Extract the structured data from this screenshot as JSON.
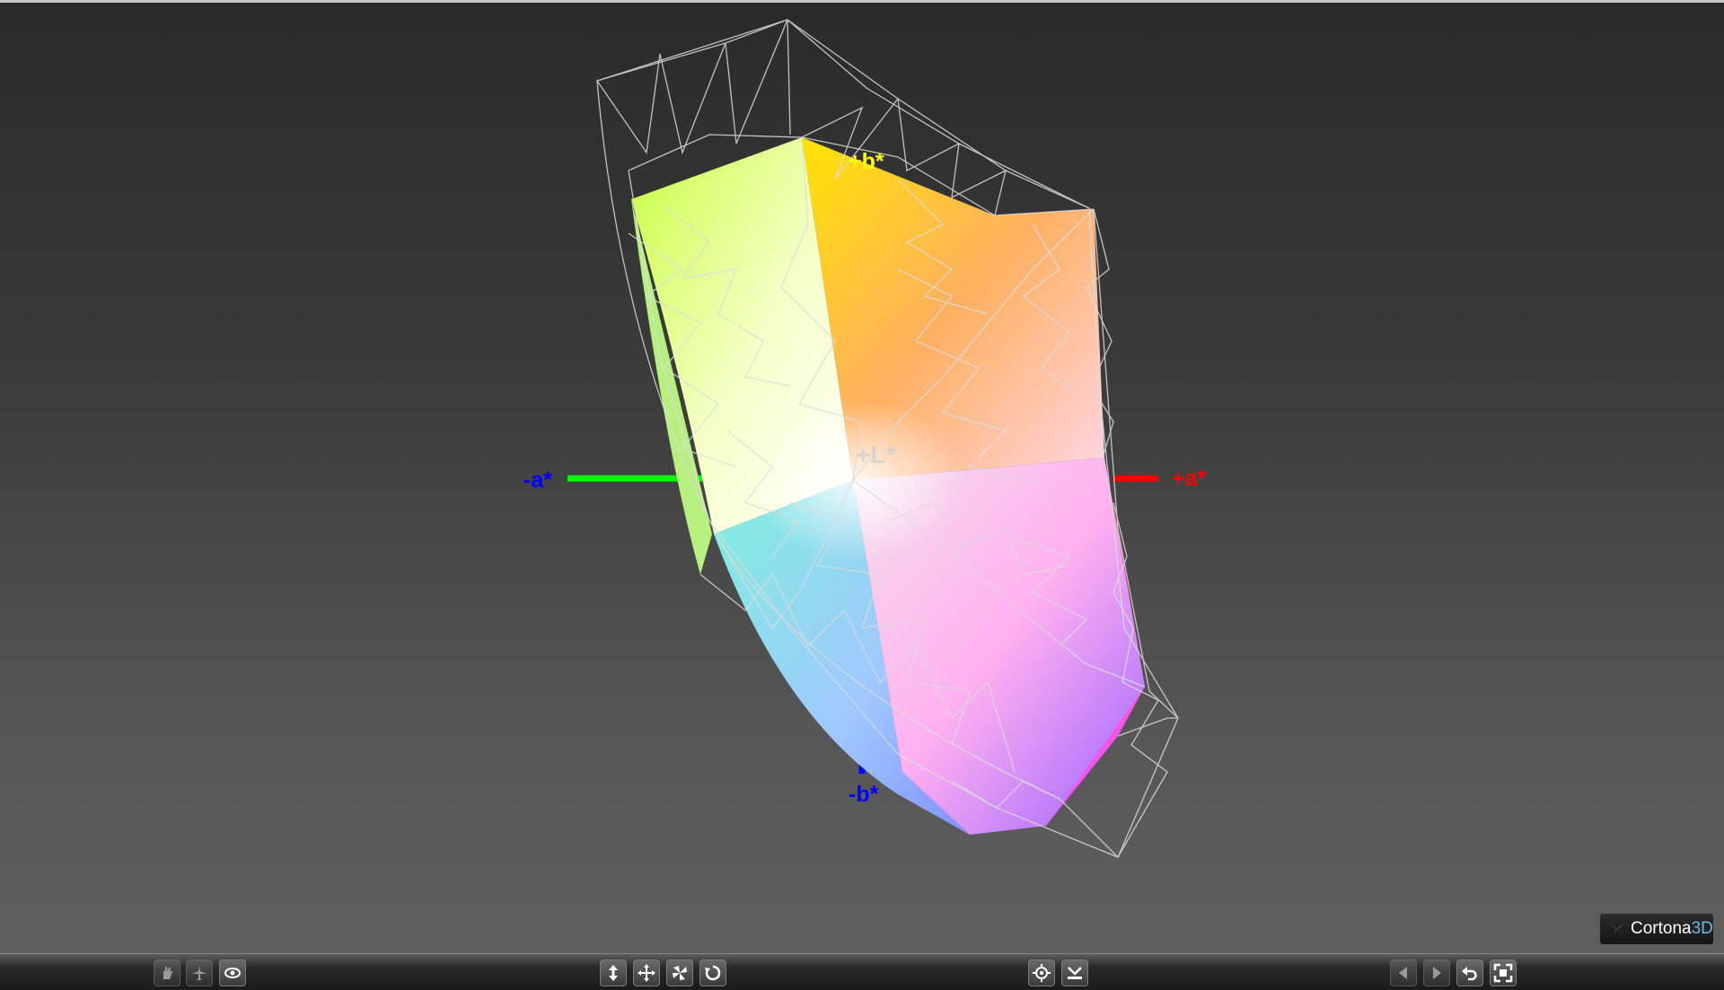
{
  "viewer": {
    "axes": {
      "plus_a": "+a*",
      "minus_a": "-a*",
      "plus_b": "+b*",
      "minus_b": "-b*",
      "plus_l": "+L*"
    },
    "colors": {
      "plus_a": "#ff0000",
      "minus_a": "#0000ff",
      "plus_b": "#ffff00",
      "minus_b": "#0000ff",
      "plus_l": "#d0d0d0",
      "green_axis": "#00ff00",
      "blue_axis": "#0000ff"
    },
    "logo": {
      "name": "Cortona",
      "suffix": "3D"
    }
  },
  "toolbar": {
    "left_group": [
      "hand-icon",
      "plane-icon",
      "eye-icon"
    ],
    "mid_group": [
      "pan-vertical-icon",
      "move-icon",
      "fan-icon",
      "rotate-icon"
    ],
    "center_group": [
      "target-icon",
      "floor-icon"
    ],
    "right_group": [
      "prev-view-icon",
      "next-view-icon",
      "undo-icon",
      "fullscreen-icon"
    ]
  }
}
